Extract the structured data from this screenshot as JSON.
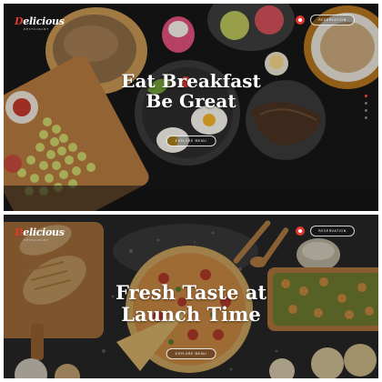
{
  "brand": {
    "name_accent": "D",
    "name_rest": "elicious",
    "tagline": "RESTAURANT"
  },
  "slides": [
    {
      "heading_lines": [
        "Eat Breakfast",
        "Be Great"
      ],
      "reserve_label": "RESERVATION",
      "explore_label": "EXPLORE MENU",
      "pager_count": 4,
      "pager_active_index": 0
    },
    {
      "heading_lines": [
        "Fresh Taste at",
        "Launch Time"
      ],
      "reserve_label": "RESERVATION",
      "explore_label": "EXPLORE MENU"
    }
  ],
  "colors": {
    "accent": "#e03a2c",
    "table_dark": "#151515",
    "flour_board": "#2a2a2a",
    "wood": "#b5793f"
  }
}
